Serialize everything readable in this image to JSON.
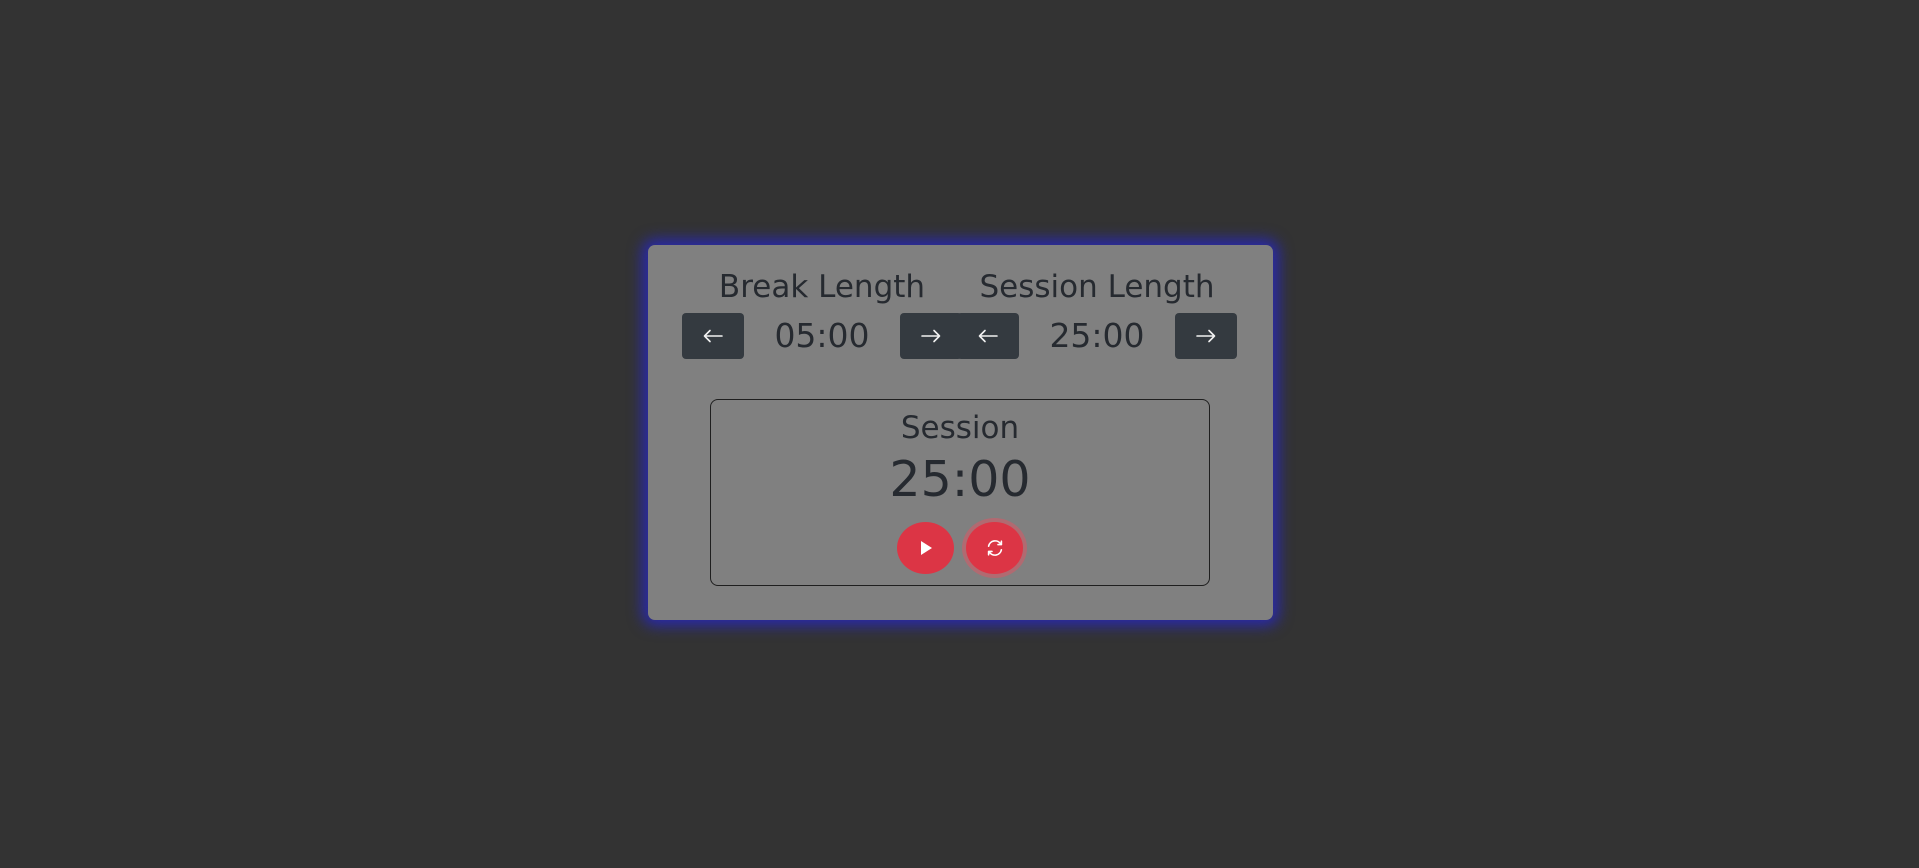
{
  "break": {
    "title": "Break Length",
    "value": "05:00",
    "decrement_icon": "arrow-left-icon",
    "increment_icon": "arrow-right-icon"
  },
  "session": {
    "title": "Session Length",
    "value": "25:00",
    "decrement_icon": "arrow-left-icon",
    "increment_icon": "arrow-right-icon"
  },
  "timer": {
    "label": "Session",
    "time": "25:00",
    "start_icon": "play-icon",
    "reset_icon": "refresh-icon"
  },
  "colors": {
    "background": "#333333",
    "card": "#808080",
    "glow": "#2828be",
    "button_dark": "#343a40",
    "button_red": "#dc3545"
  }
}
